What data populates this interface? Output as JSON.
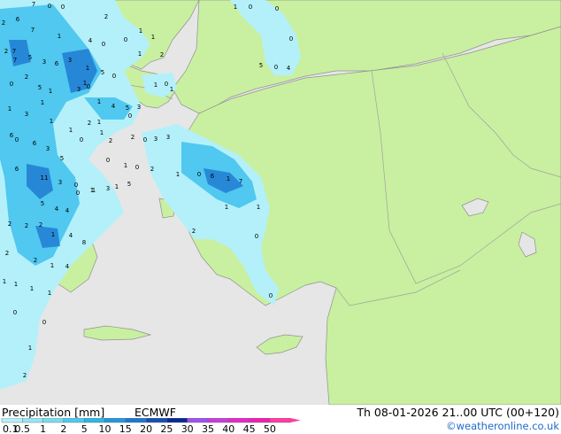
{
  "footer": {
    "title": "Precipitation [mm]",
    "model": "ECMWF",
    "valid": "Th 08-01-2026 21..00 UTC (00+120)",
    "credit": "©weatheronline.co.uk"
  },
  "legend": {
    "ticks": [
      "0.1",
      "0.5",
      "1",
      "2",
      "5",
      "10",
      "15",
      "20",
      "25",
      "30",
      "35",
      "40",
      "45",
      "50"
    ],
    "colors": [
      "#b4f0fa",
      "#96e6f5",
      "#78dcf0",
      "#50c8f0",
      "#30b4e6",
      "#2896dc",
      "#1e78d2",
      "#1450b4",
      "#0a2896",
      "#a050f0",
      "#c83cdc",
      "#e628c8",
      "#f01eb4",
      "#ff3ca0"
    ]
  },
  "colors": {
    "sea": "#e6e6e6",
    "land": "#c8f0a0",
    "border": "#a0a0a0",
    "precip_light": "#b4f0fa",
    "precip_moderate": "#50c8f0",
    "precip_heavy": "#1e78d2"
  },
  "map_labels": [
    "2",
    "7",
    "0",
    "2",
    "6",
    "7",
    "0",
    "1",
    "2",
    "4",
    "0",
    "7",
    "5",
    "3",
    "6",
    "3",
    "1",
    "5",
    "7",
    "2",
    "1",
    "0",
    "5",
    "1",
    "0",
    "1",
    "3",
    "1",
    "1",
    "6",
    "0",
    "0",
    "6",
    "3",
    "5",
    "0",
    "6",
    "11",
    "3",
    "0",
    "1",
    "1",
    "5",
    "4",
    "4",
    "2",
    "1",
    "2",
    "2",
    "4",
    "8",
    "2",
    "1",
    "2",
    "4",
    "1",
    "1",
    "1",
    "1",
    "0",
    "0",
    "2",
    "0",
    "3",
    "3",
    "1",
    "0",
    "2",
    "5",
    "3",
    "1",
    "0",
    "0",
    "1",
    "4",
    "5",
    "3",
    "1",
    "0",
    "1",
    "1",
    "2",
    "1",
    "0",
    "6",
    "1",
    "7",
    "1",
    "1",
    "2",
    "0",
    "0",
    "1",
    "2",
    "5",
    "0",
    "4",
    "0",
    "0",
    "0",
    "1",
    "1",
    "1",
    "0",
    "0",
    "3",
    "2",
    "1",
    "2",
    "1",
    "1",
    "3"
  ]
}
